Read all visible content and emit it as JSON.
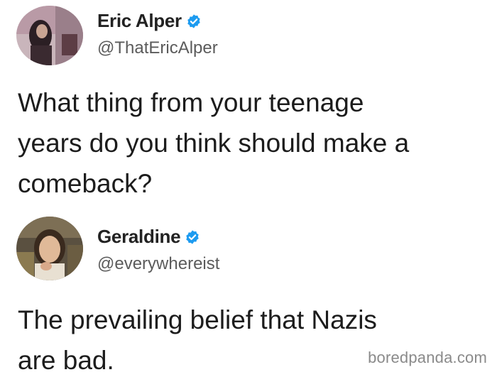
{
  "tweets": [
    {
      "display_name": "Eric Alper",
      "handle": "@ThatEricAlper",
      "verified": true,
      "text_lines": [
        "What thing from your teenage",
        "years do you think should make a",
        "comeback?"
      ]
    },
    {
      "display_name": "Geraldine",
      "handle": "@everywhereist",
      "verified": true,
      "text_lines": [
        "The prevailing belief that Nazis",
        "are bad."
      ]
    }
  ],
  "watermark": "boredpanda.com",
  "colors": {
    "verified_badge": "#1d9bf0",
    "text": "#1c1c1c",
    "handle": "#5b5b5b",
    "watermark": "#8a8a8a"
  },
  "icons": {
    "verified": "verified-badge-icon"
  }
}
